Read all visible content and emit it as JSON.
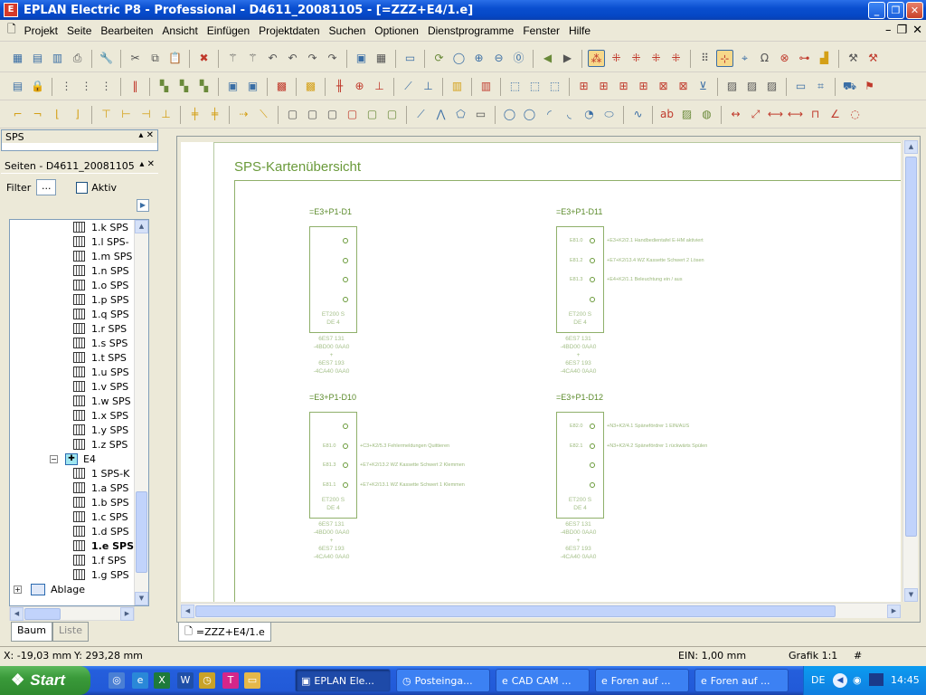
{
  "window": {
    "title": "EPLAN Electric P8 - Professional - D4611_20081105 - [=ZZZ+E4/1.e]"
  },
  "menu": [
    "Projekt",
    "Seite",
    "Bearbeiten",
    "Ansicht",
    "Einfügen",
    "Projektdaten",
    "Suchen",
    "Optionen",
    "Dienstprogramme",
    "Fenster",
    "Hilfe"
  ],
  "sps_panel": {
    "title": "SPS"
  },
  "seiten_panel": {
    "title": "Seiten - D4611_20081105",
    "filter_label": "Filter",
    "filter_button": "...",
    "aktiv_label": "Aktiv",
    "tree_top": [
      "1.k SPS",
      "1.l SPS-",
      "1.m SPS",
      "1.n SPS",
      "1.o SPS",
      "1.p SPS",
      "1.q SPS",
      "1.r SPS",
      "1.s SPS",
      "1.t SPS",
      "1.u SPS",
      "1.v SPS",
      "1.w SPS",
      "1.x SPS",
      "1.y SPS",
      "1.z SPS"
    ],
    "group_e4": "E4",
    "tree_e4": [
      "1 SPS-K",
      "1.a SPS",
      "1.b SPS",
      "1.c SPS",
      "1.d SPS",
      "1.e SPS",
      "1.f SPS",
      "1.g SPS"
    ],
    "ablage": "Ablage",
    "tab_baum": "Baum",
    "tab_liste": "Liste"
  },
  "document": {
    "tab": "=ZZZ+E4/1.e",
    "sheet_title": "SPS-Kartenübersicht",
    "cards": [
      {
        "title": "=E3+P1-D1",
        "pins": [
          {
            "addr": "",
            "text": ""
          },
          {
            "addr": "",
            "text": ""
          },
          {
            "addr": "",
            "text": ""
          },
          {
            "addr": "",
            "text": ""
          }
        ],
        "module": [
          "ET200 S",
          "DE 4"
        ],
        "order": [
          "6ES7 131",
          "-4BD00 0AA0",
          "+",
          "6ES7 193",
          "-4CA40 0AA0"
        ]
      },
      {
        "title": "=E3+P1-D11",
        "pins": [
          {
            "addr": "E81.0",
            "text": "+E3+K2/2.1     Handbedientafel E-HM aktiviert"
          },
          {
            "addr": "E81.2",
            "text": "+E7+K2/13.4     WZ Kassette Schwert 2 Lösen"
          },
          {
            "addr": "E81.3",
            "text": "+E4+K2/1.1     Beleuchtung ein / aus"
          },
          {
            "addr": "",
            "text": ""
          }
        ],
        "module": [
          "ET200 S",
          "DE 4"
        ],
        "order": [
          "6ES7 131",
          "-4BD00 0AA0",
          "+",
          "6ES7 193",
          "-4CA40 0AA0"
        ]
      },
      {
        "title": "=E3+P1-D10",
        "pins": [
          {
            "addr": "",
            "text": ""
          },
          {
            "addr": "E81.0",
            "text": "+C3+K2/5.3     Fehlermeldungen Quittieren"
          },
          {
            "addr": "E81.3",
            "text": "+E7+K2/13.2     WZ Kassette Schwert 2 Klemmen"
          },
          {
            "addr": "E81.1",
            "text": "+E7+K2/13.1     WZ Kassette Schwert 1 Klemmen"
          }
        ],
        "module": [
          "ET200 S",
          "DE 4"
        ],
        "order": [
          "6ES7 131",
          "-4BD00 0AA0",
          "+",
          "6ES7 193",
          "-4CA40 0AA0"
        ]
      },
      {
        "title": "=E3+P1-D12",
        "pins": [
          {
            "addr": "E82.0",
            "text": "+N3+K2/4.1     Spänefördrer 1 EIN/AUS"
          },
          {
            "addr": "E82.1",
            "text": "+N3+K2/4.2     Spänefördrer 1 rückwärts Spülen"
          },
          {
            "addr": "",
            "text": ""
          },
          {
            "addr": "",
            "text": ""
          }
        ],
        "module": [
          "ET200 S",
          "DE 4"
        ],
        "order": [
          "6ES7 131",
          "-4BD00 0AA0",
          "+",
          "6ES7 193",
          "-4CA40 0AA0"
        ]
      }
    ]
  },
  "status": {
    "x": "X: -19,03 mm",
    "y": "Y: 293,28 mm",
    "ein": "EIN: 1,00 mm",
    "grafik": "Grafik 1:1",
    "hash": "#"
  },
  "taskbar": {
    "start": "Start",
    "tasks": [
      "EPLAN Ele...",
      "Posteinga...",
      "CAD CAM ...",
      "Foren auf ...",
      "Foren auf ..."
    ],
    "lang": "DE",
    "clock": "14:45"
  }
}
